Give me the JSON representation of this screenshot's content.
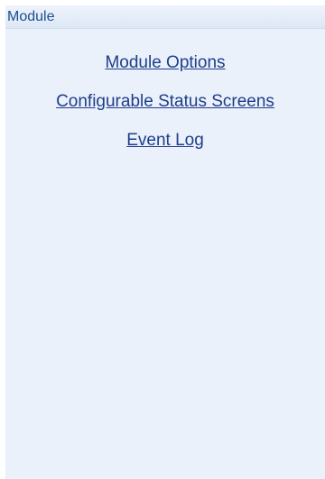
{
  "panel": {
    "title": "Module",
    "links": [
      {
        "label": "Module Options"
      },
      {
        "label": "Configurable Status Screens"
      },
      {
        "label": "Event Log"
      }
    ]
  },
  "colors": {
    "panel_background": "#eaf1fb",
    "header_text": "#1a4f8f",
    "link_text": "#1f3d8a"
  }
}
